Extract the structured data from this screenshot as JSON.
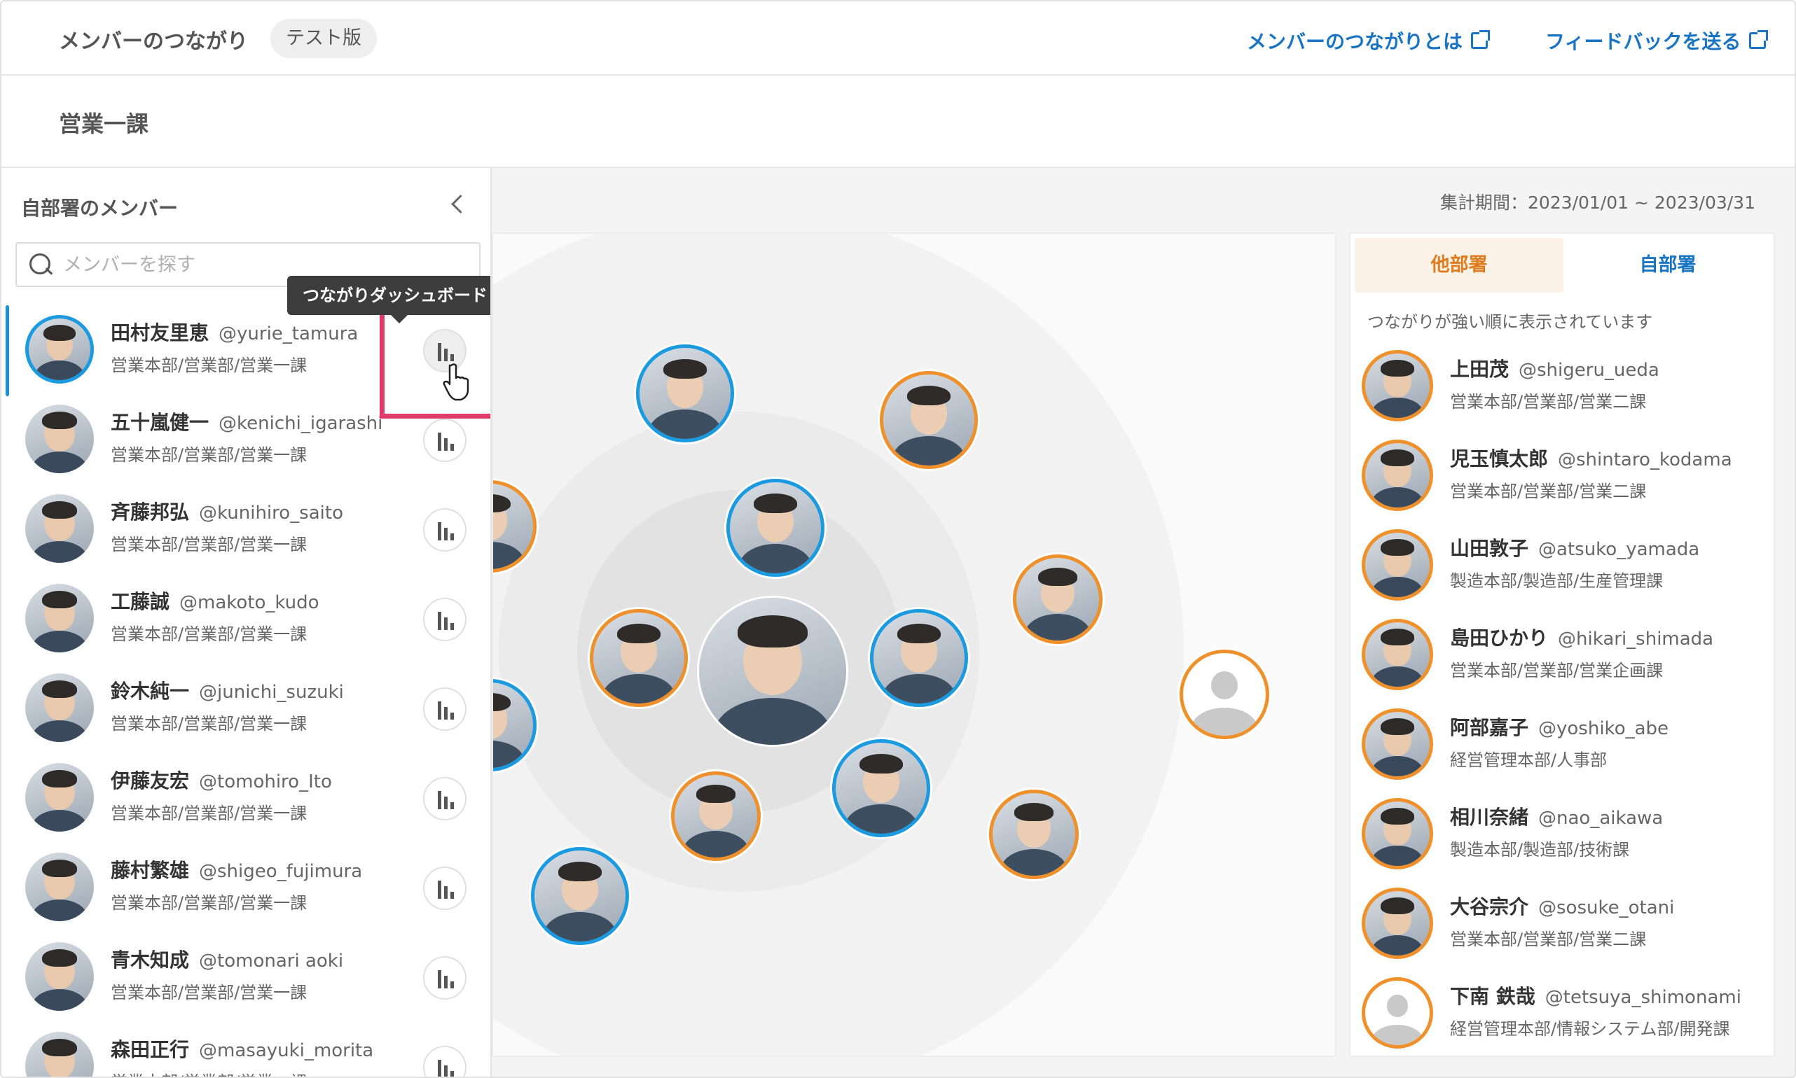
{
  "header": {
    "title": "メンバーのつながり",
    "badge": "テスト版",
    "link_about": "メンバーのつながりとは",
    "link_feedback": "フィードバックを送る"
  },
  "department": {
    "title": "営業一課"
  },
  "sidebar": {
    "title": "自部署のメンバー",
    "search_placeholder": "メンバーを探す",
    "tooltip": "つながりダッシュボード",
    "members": [
      {
        "name": "田村友里恵",
        "handle": "@yurie_tamura",
        "dept": "営業本部/営業部/営業一課",
        "selected": true
      },
      {
        "name": "五十嵐健一",
        "handle": "@kenichi_igarashi",
        "dept": "営業本部/営業部/営業一課"
      },
      {
        "name": "斉藤邦弘",
        "handle": "@kunihiro_saito",
        "dept": "営業本部/営業部/営業一課"
      },
      {
        "name": "工藤誠",
        "handle": "@makoto_kudo",
        "dept": "営業本部/営業部/営業一課"
      },
      {
        "name": "鈴木純一",
        "handle": "@junichi_suzuki",
        "dept": "営業本部/営業部/営業一課"
      },
      {
        "name": "伊藤友宏",
        "handle": "@tomohiro_Ito",
        "dept": "営業本部/営業部/営業一課"
      },
      {
        "name": "藤村繁雄",
        "handle": "@shigeo_fujimura",
        "dept": "営業本部/営業部/営業一課"
      },
      {
        "name": "青木知成",
        "handle": "@tomonari aoki",
        "dept": "営業本部/営業部/営業一課"
      },
      {
        "name": "森田正行",
        "handle": "@masayuki_morita",
        "dept": "営業本部/営業部/営業一課"
      }
    ]
  },
  "main": {
    "period": "集計期間：2023/01/01 ~ 2023/03/31"
  },
  "panel": {
    "tab_other": "他部署",
    "tab_own": "自部署",
    "sort_note": "つながりが強い順に表示されています",
    "connections": [
      {
        "name": "上田茂",
        "handle": "@shigeru_ueda",
        "dept": "営業本部/営業部/営業二課"
      },
      {
        "name": "児玉慎太郎",
        "handle": "@shintaro_kodama",
        "dept": "営業本部/営業部/営業二課"
      },
      {
        "name": "山田敦子",
        "handle": "@atsuko_yamada",
        "dept": "製造本部/製造部/生産管理課"
      },
      {
        "name": "島田ひかり",
        "handle": "@hikari_shimada",
        "dept": "営業本部/営業部/営業企画課"
      },
      {
        "name": "阿部嘉子",
        "handle": "@yoshiko_abe",
        "dept": "経営管理本部/人事部"
      },
      {
        "name": "相川奈緒",
        "handle": "@nao_aikawa",
        "dept": "製造本部/製造部/技術課"
      },
      {
        "name": "大谷宗介",
        "handle": "@sosuke_otani",
        "dept": "営業本部/営業部/営業二課"
      },
      {
        "name": "下南 鉄哉",
        "handle": "@tetsuya_shimonami",
        "dept": "経営管理本部/情報システム部/開発課",
        "placeholder": true
      }
    ]
  },
  "colors": {
    "accent_blue": "#1a9ae0",
    "accent_orange": "#f0902a",
    "link": "#1a74c4",
    "highlight": "#e23a6a"
  }
}
